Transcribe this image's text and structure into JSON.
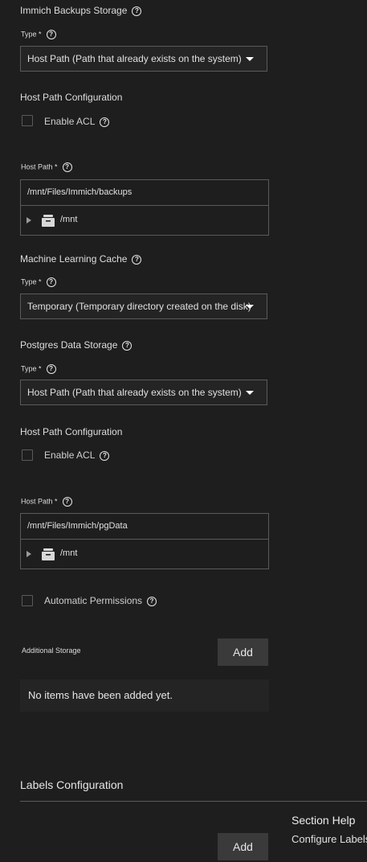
{
  "immich_backups": {
    "title": "Immich Backups Storage",
    "type_label": "Type *",
    "type_value": "Host Path (Path that already exists on the system)",
    "host_path_config_title": "Host Path Configuration",
    "enable_acl_label": "Enable ACL",
    "host_path_label": "Host Path *",
    "host_path_value": "/mnt/Files/Immich/backups",
    "tree_root": "/mnt"
  },
  "ml_cache": {
    "title": "Machine Learning Cache",
    "type_label": "Type *",
    "type_value": "Temporary (Temporary directory created on the disk)"
  },
  "postgres": {
    "title": "Postgres Data Storage",
    "type_label": "Type *",
    "type_value": "Host Path (Path that already exists on the system)",
    "host_path_config_title": "Host Path Configuration",
    "enable_acl_label": "Enable ACL",
    "host_path_label": "Host Path *",
    "host_path_value": "/mnt/Files/Immich/pgData",
    "tree_root": "/mnt",
    "auto_permissions_label": "Automatic Permissions"
  },
  "additional_storage": {
    "label": "Additional Storage",
    "add_label": "Add",
    "empty_text": "No items have been added yet."
  },
  "labels_config": {
    "title": "Labels Configuration",
    "add_label": "Add"
  },
  "section_help": {
    "title": "Section Help",
    "text": "Configure Labels"
  }
}
